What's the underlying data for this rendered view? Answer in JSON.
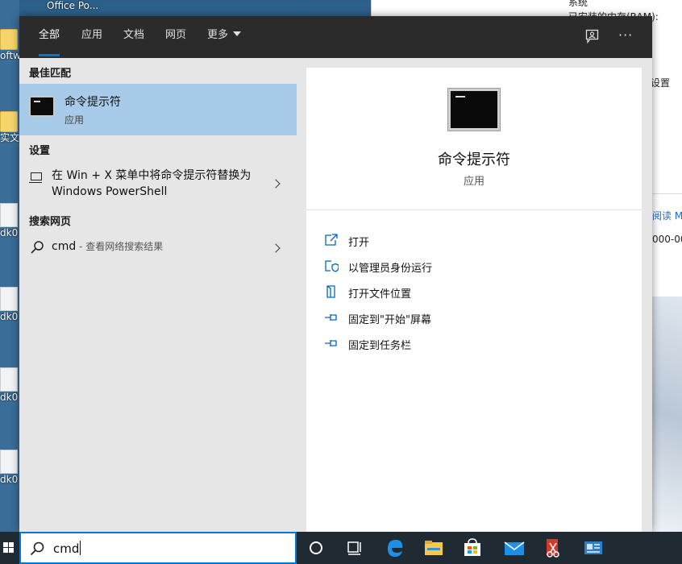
{
  "desktop": {
    "top_label": "Office Po...",
    "icons": [
      "oftwa",
      "实文",
      "dk0",
      "dk0",
      "dk0",
      "dk0"
    ],
    "background_window": {
      "line1": "系统",
      "line2": "已安装的内存(RAM):",
      "line3": "设置",
      "link": "阅读 M",
      "code": "000-00"
    }
  },
  "tabs": {
    "all": "全部",
    "apps": "应用",
    "docs": "文档",
    "web": "网页",
    "more": "更多",
    "more_icon": "ellipsis-icon",
    "feedback_icon": "feedback-icon"
  },
  "results": {
    "best_match_title": "最佳匹配",
    "best_match_name": "命令提示符",
    "best_match_type": "应用",
    "settings_title": "设置",
    "settings_item": "在 Win + X 菜单中将命令提示符替换为 Windows PowerShell",
    "web_title": "搜索网页",
    "web_query": "cmd",
    "web_hint": " - 查看网络搜索结果"
  },
  "preview": {
    "name": "命令提示符",
    "type": "应用",
    "actions": {
      "open": "打开",
      "run_as_admin": "以管理员身份运行",
      "open_location": "打开文件位置",
      "pin_start": "固定到\"开始\"屏幕",
      "pin_taskbar": "固定到任务栏"
    }
  },
  "search": {
    "query": "cmd"
  },
  "colors": {
    "accent": "#0078d7",
    "selection": "#a8cbe9",
    "tabbar": "#2b2b2b",
    "taskbar": "#1f2a33"
  }
}
